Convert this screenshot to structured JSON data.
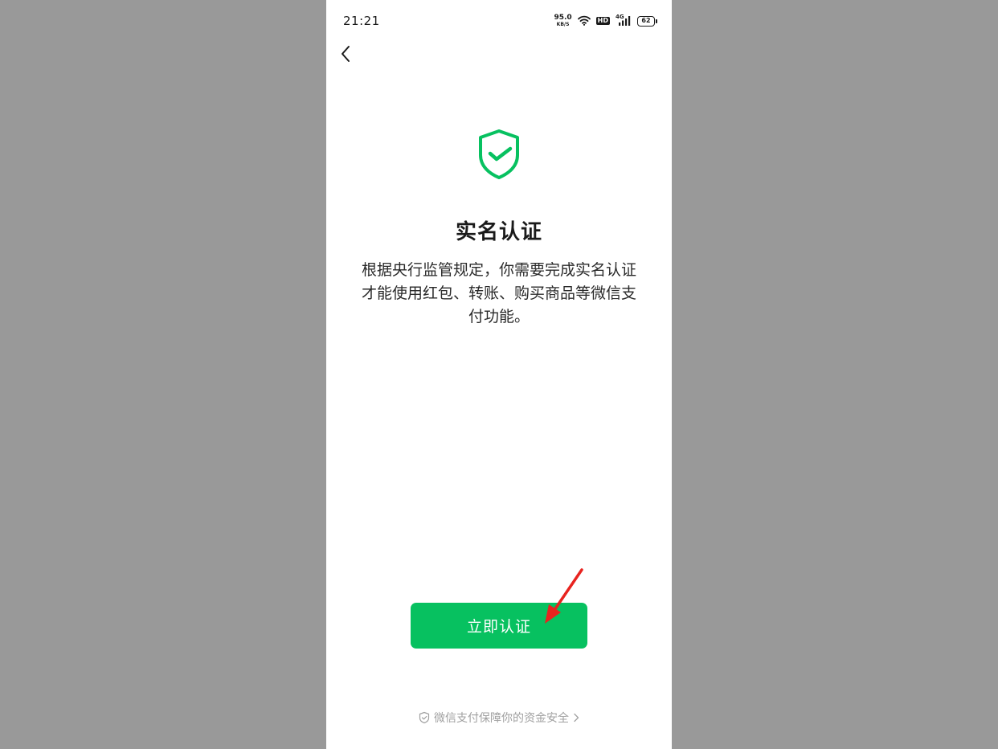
{
  "status_bar": {
    "time": "21:21",
    "net_speed_value": "95.0",
    "net_speed_unit": "KB/S",
    "hd_label": "HD",
    "network_label": "4G",
    "battery_level": "62",
    "icons": [
      "wifi-icon",
      "hd-icon",
      "signal-4g-icon",
      "battery-icon"
    ]
  },
  "nav": {
    "back_icon": "chevron-left-icon"
  },
  "content": {
    "icon": "shield-check-icon",
    "title": "实名认证",
    "description": "根据央行监管规定，你需要完成实名认证才能使用红包、转账、购买商品等微信支付功能。"
  },
  "actions": {
    "primary_button_label": "立即认证"
  },
  "footer": {
    "text": "微信支付保障你的资金安全",
    "icons": [
      "shield-small-icon",
      "chevron-right-icon"
    ]
  },
  "colors": {
    "accent": "#07c160",
    "page_background": "#999999",
    "annotation_arrow": "#e8231f"
  }
}
